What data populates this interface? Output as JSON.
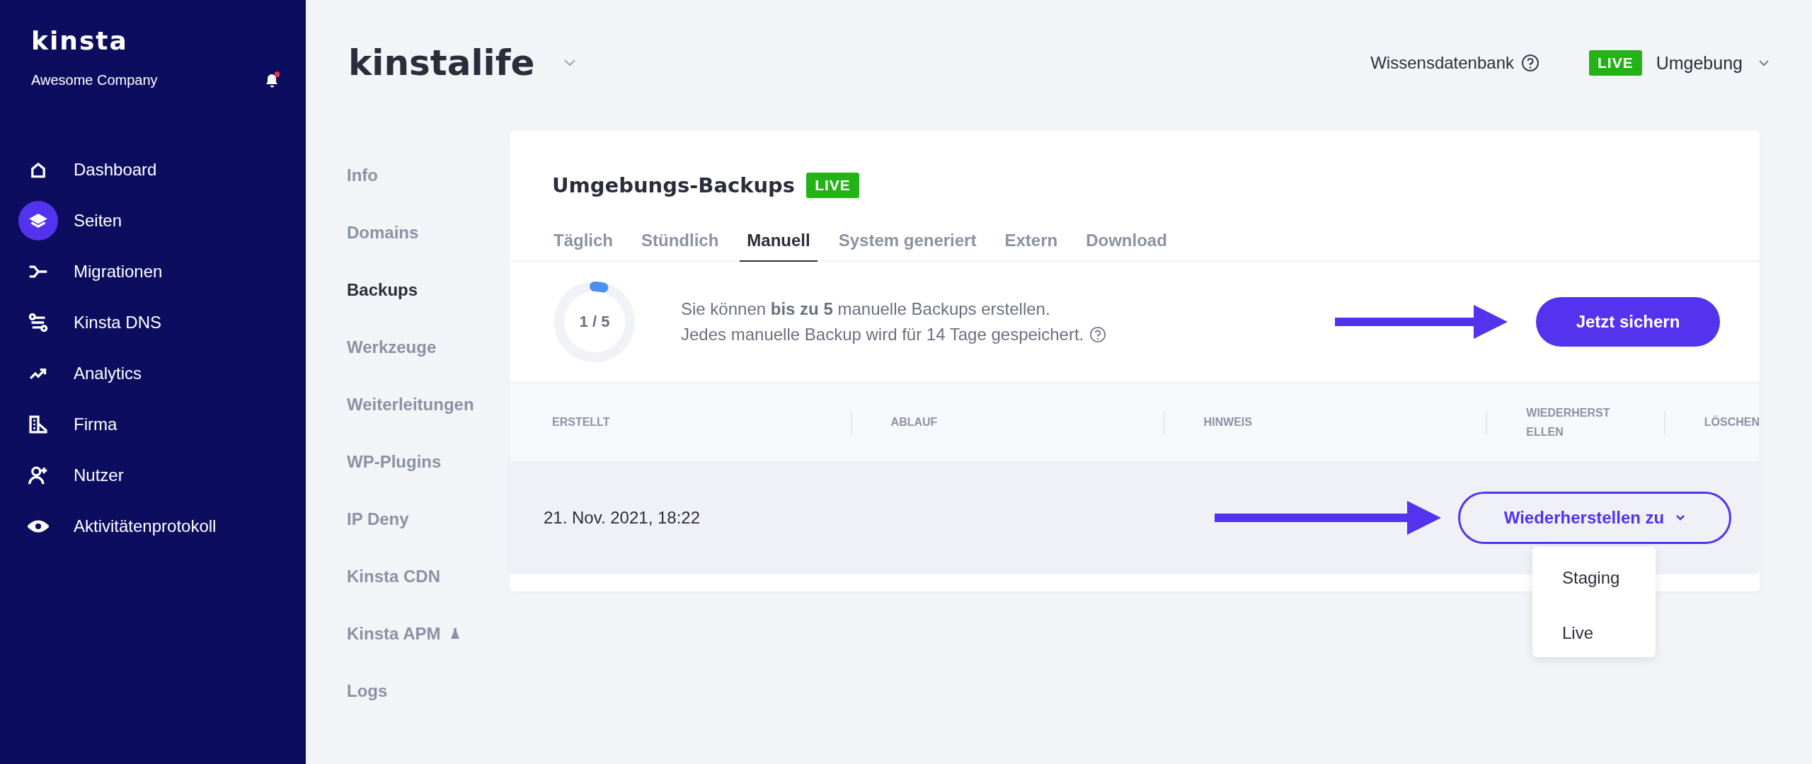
{
  "sidebar": {
    "logo": "kinsta",
    "company": "Awesome Company",
    "notifications_unread": true,
    "items": [
      {
        "label": "Dashboard",
        "selected": false
      },
      {
        "label": "Seiten",
        "selected": true
      },
      {
        "label": "Migrationen",
        "selected": false
      },
      {
        "label": "Kinsta DNS",
        "selected": false
      },
      {
        "label": "Analytics",
        "selected": false
      },
      {
        "label": "Firma",
        "selected": false
      },
      {
        "label": "Nutzer",
        "selected": false
      },
      {
        "label": "Aktivitätenprotokoll",
        "selected": false
      }
    ]
  },
  "header": {
    "site_name": "kinstalife",
    "knowledge_base": "Wissensdatenbank",
    "environment_badge": "LIVE",
    "environment": "Umgebung"
  },
  "subnav": [
    {
      "label": "Info",
      "selected": false
    },
    {
      "label": "Domains",
      "selected": false
    },
    {
      "label": "Backups",
      "selected": true
    },
    {
      "label": "Werkzeuge",
      "selected": false
    },
    {
      "label": "Weiterleitungen",
      "selected": false
    },
    {
      "label": "WP-Plugins",
      "selected": false
    },
    {
      "label": "IP Deny",
      "selected": false
    },
    {
      "label": "Kinsta CDN",
      "selected": false
    },
    {
      "label": "Kinsta APM",
      "selected": false,
      "beta": true
    },
    {
      "label": "Logs",
      "selected": false
    }
  ],
  "card": {
    "title": "Umgebungs-Backups",
    "badge": "LIVE",
    "tabs": [
      {
        "label": "Täglich",
        "selected": false
      },
      {
        "label": "Stündlich",
        "selected": false
      },
      {
        "label": "Manuell",
        "selected": true
      },
      {
        "label": "System generiert",
        "selected": false
      },
      {
        "label": "Extern",
        "selected": false
      },
      {
        "label": "Download",
        "selected": false
      }
    ],
    "usage": {
      "reading": "1 / 5",
      "level": 0.04
    },
    "info_lines": [
      "Sie können **bis zu 5** manuelle Backups erstellen.",
      "Jedes manuelle Backup wird für 14 Tage gespeichert."
    ],
    "backup_button": "Jetzt sichern",
    "table": {
      "columns": [
        "ERSTELLT",
        "ABLAUF",
        "HINWEIS",
        "WIEDERHERSTELLEN",
        "LÖSCHEN"
      ],
      "rows": [
        {
          "created": "21. Nov. 2021, 18:22",
          "restore_button": "Wiederherstellen zu",
          "menu_open": true
        }
      ]
    },
    "restore_menu": [
      "Staging",
      "Live"
    ]
  }
}
